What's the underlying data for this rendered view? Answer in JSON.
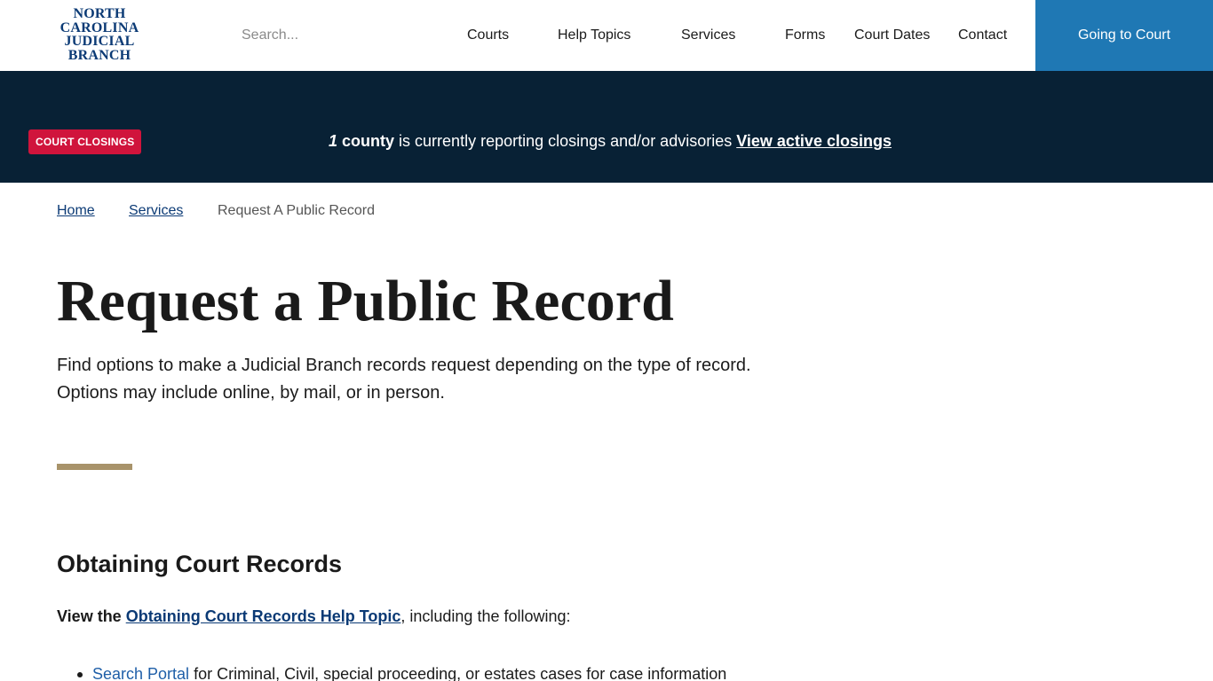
{
  "header": {
    "logo_lines": [
      "NORTH",
      "CAROLINA",
      "JUDICIAL",
      "BRANCH"
    ],
    "search_placeholder": "Search...",
    "nav": [
      "Courts",
      "Help Topics",
      "Services",
      "Forms",
      "Court Dates",
      "Contact"
    ],
    "cta": "Going to Court",
    "cta_color": "#1f78b4"
  },
  "alert": {
    "badge": "COURT CLOSINGS",
    "count": "1",
    "count_unit": "county",
    "message": " is currently reporting closings and/or advisories ",
    "link": "View active closings",
    "bg_color": "#082135",
    "badge_color": "#d0143c"
  },
  "breadcrumb": {
    "home": "Home",
    "services": "Services",
    "current": "Request A Public Record"
  },
  "main": {
    "title": "Request a Public Record",
    "intro": "Find options to make a Judicial Branch records request depending on the type of record. Options may include online, by mail, or in person.",
    "section_title": "Obtaining Court Records",
    "view_prefix": "View the ",
    "view_link": "Obtaining Court Records Help Topic",
    "view_suffix": ", including the following:",
    "list": [
      {
        "link": "Search Portal",
        "text": " for Criminal, Civil, special proceeding, or estates cases for case information"
      }
    ]
  }
}
